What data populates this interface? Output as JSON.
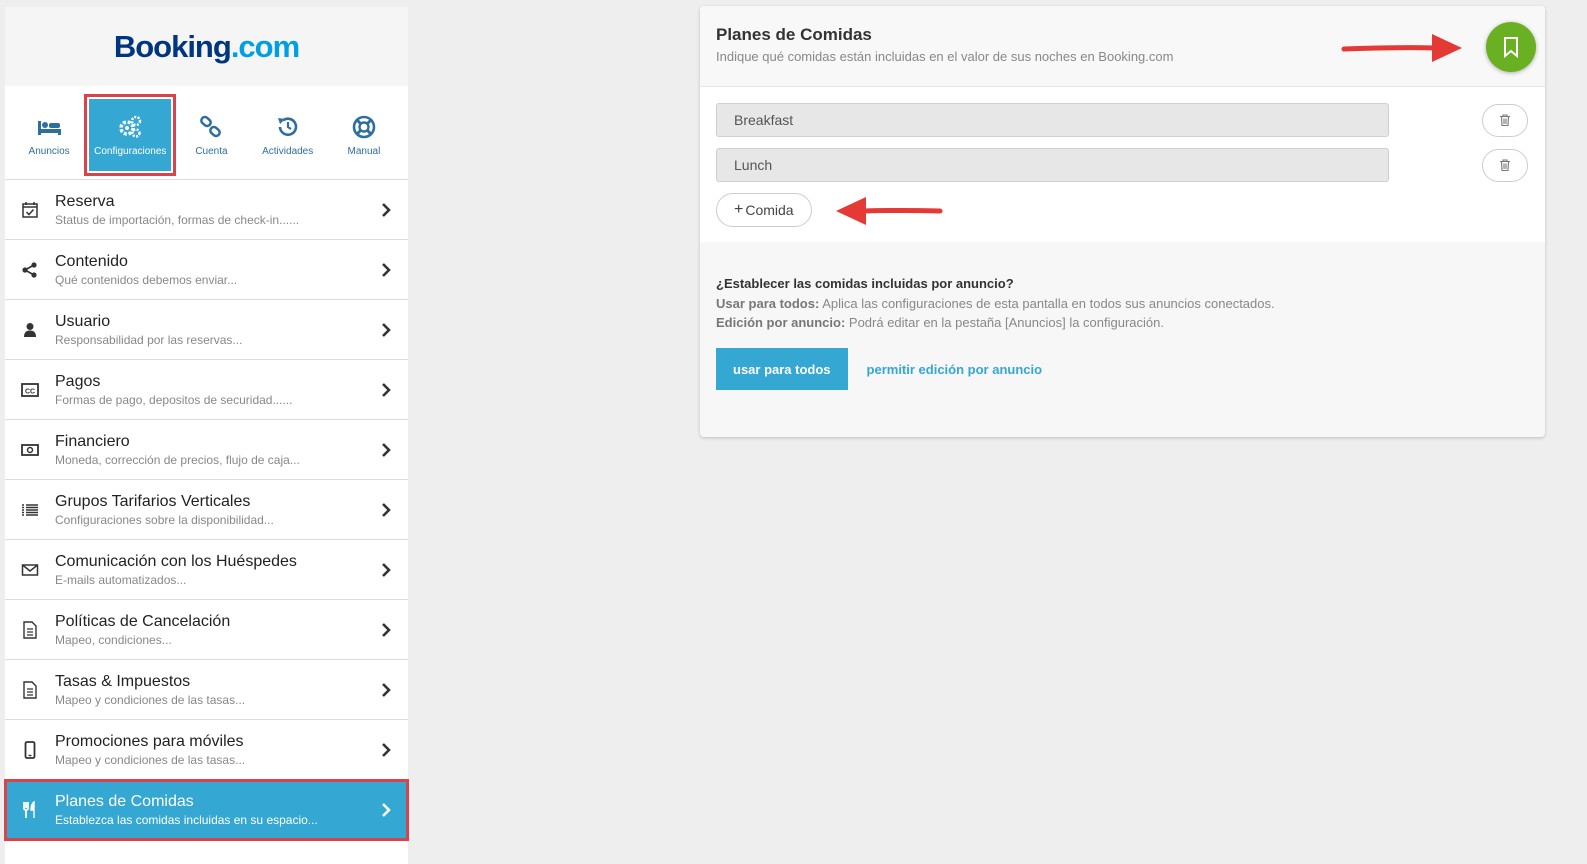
{
  "brand": {
    "part1": "Booking",
    "part2": ".com"
  },
  "topnav": [
    {
      "label": "Anuncios",
      "icon": "bed-icon"
    },
    {
      "label": "Configuraciones",
      "icon": "gears-icon",
      "active": true
    },
    {
      "label": "Cuenta",
      "icon": "link-icon"
    },
    {
      "label": "Actividades",
      "icon": "history-icon"
    },
    {
      "label": "Manual",
      "icon": "lifebuoy-icon"
    }
  ],
  "menu": [
    {
      "title": "Reserva",
      "sub": "Status de importación, formas de check-in......",
      "icon": "calendar-check-icon"
    },
    {
      "title": "Contenido",
      "sub": "Qué contenidos debemos enviar...",
      "icon": "share-icon"
    },
    {
      "title": "Usuario",
      "sub": "Responsabilidad por las reservas...",
      "icon": "user-icon"
    },
    {
      "title": "Pagos",
      "sub": "Formas de pago, depositos de securidad......",
      "icon": "credit-card-icon"
    },
    {
      "title": "Financiero",
      "sub": "Moneda, corrección de precios, flujo de caja...",
      "icon": "money-icon"
    },
    {
      "title": "Grupos Tarifarios Verticales",
      "sub": "Configuraciones sobre la disponibilidad...",
      "icon": "list-icon"
    },
    {
      "title": "Comunicación con los Huéspedes",
      "sub": "E-mails automatizados...",
      "icon": "envelope-icon"
    },
    {
      "title": "Políticas de Cancelación",
      "sub": "Mapeo, condiciones...",
      "icon": "document-icon"
    },
    {
      "title": "Tasas & Impuestos",
      "sub": "Mapeo y condiciones de las tasas...",
      "icon": "document-icon"
    },
    {
      "title": "Promociones para móviles",
      "sub": "Mapeo y condiciones de las tasas...",
      "icon": "mobile-icon"
    },
    {
      "title": "Planes de Comidas",
      "sub": "Establezca las comidas incluidas en su espacio...",
      "icon": "cutlery-icon",
      "active": true
    }
  ],
  "card": {
    "title": "Planes de Comidas",
    "subtitle": "Indique qué comidas están incluidas en el valor de sus noches en Booking.com",
    "meals": [
      "Breakfast",
      "Lunch"
    ],
    "add_label": "Comida",
    "question": "¿Establecer las comidas incluidas por anuncio?",
    "use_all_bold": "Usar para todos:",
    "use_all_text": " Aplica las configuraciones de esta pantalla en todos sus anuncios conectados.",
    "per_listing_bold": "Edición por anuncio:",
    "per_listing_text": " Podrá editar en la pestaña [Anuncios] la configuración.",
    "btn_use_all": "usar para todos",
    "btn_per_listing": "permitir edición por anuncio"
  },
  "colors": {
    "accent": "#34a7d3",
    "save": "#6ab023",
    "highlight": "#d9434a",
    "brand_dark": "#003580",
    "brand_light": "#009fe3"
  }
}
